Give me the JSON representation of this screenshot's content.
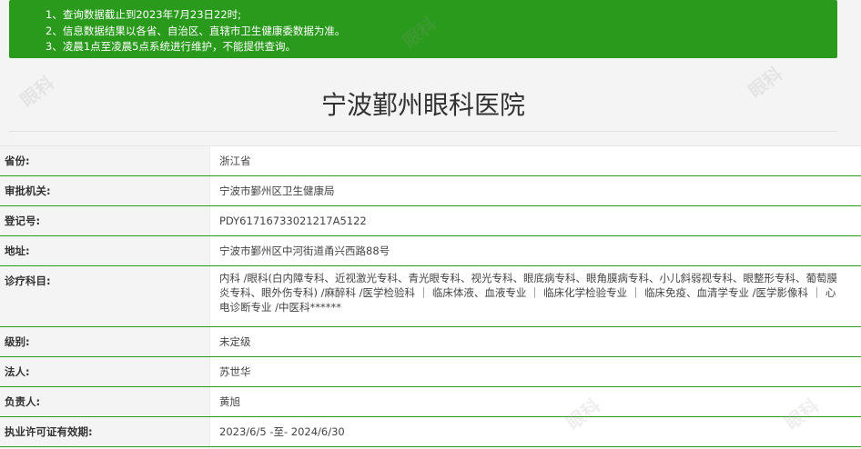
{
  "notice": {
    "lines": [
      "1、查询数据截止到2023年7月23日22时;",
      "2、信息数据结果以各省、自治区、直辖市卫生健康委数据为准。",
      "3、凌晨1点至凌晨5点系统进行维护，不能提供查询。"
    ]
  },
  "page": {
    "title": "宁波鄞州眼科医院"
  },
  "details": {
    "rows": [
      {
        "label": "省份:",
        "value": "浙江省"
      },
      {
        "label": "审批机关:",
        "value": "宁波市鄞州区卫生健康局"
      },
      {
        "label": "登记号:",
        "value": "PDY61716733021217A5122"
      },
      {
        "label": "地址:",
        "value": "宁波市鄞州区中河街道甬兴西路88号"
      },
      {
        "label": "诊疗科目:",
        "value": "内科 /眼科(白内障专科、近视激光专科、青光眼专科、视光专科、眼底病专科、眼角膜病专科、小儿斜弱视专科、眼整形专科、葡萄膜炎专科、眼外伤专科) /麻醉科 /医学检验科 ｜ 临床体液、血液专业 ｜ 临床化学检验专业 ｜ 临床免疫、血清学专业 /医学影像科 ｜ 心电诊断专业 /中医科******"
      },
      {
        "label": "级别:",
        "value": "未定级"
      },
      {
        "label": "法人:",
        "value": "苏世华"
      },
      {
        "label": "负责人:",
        "value": "黄旭"
      },
      {
        "label": "执业许可证有效期:",
        "value": "2023/6/5 -至- 2024/6/30"
      }
    ]
  },
  "watermark": {
    "text": "眼科"
  }
}
